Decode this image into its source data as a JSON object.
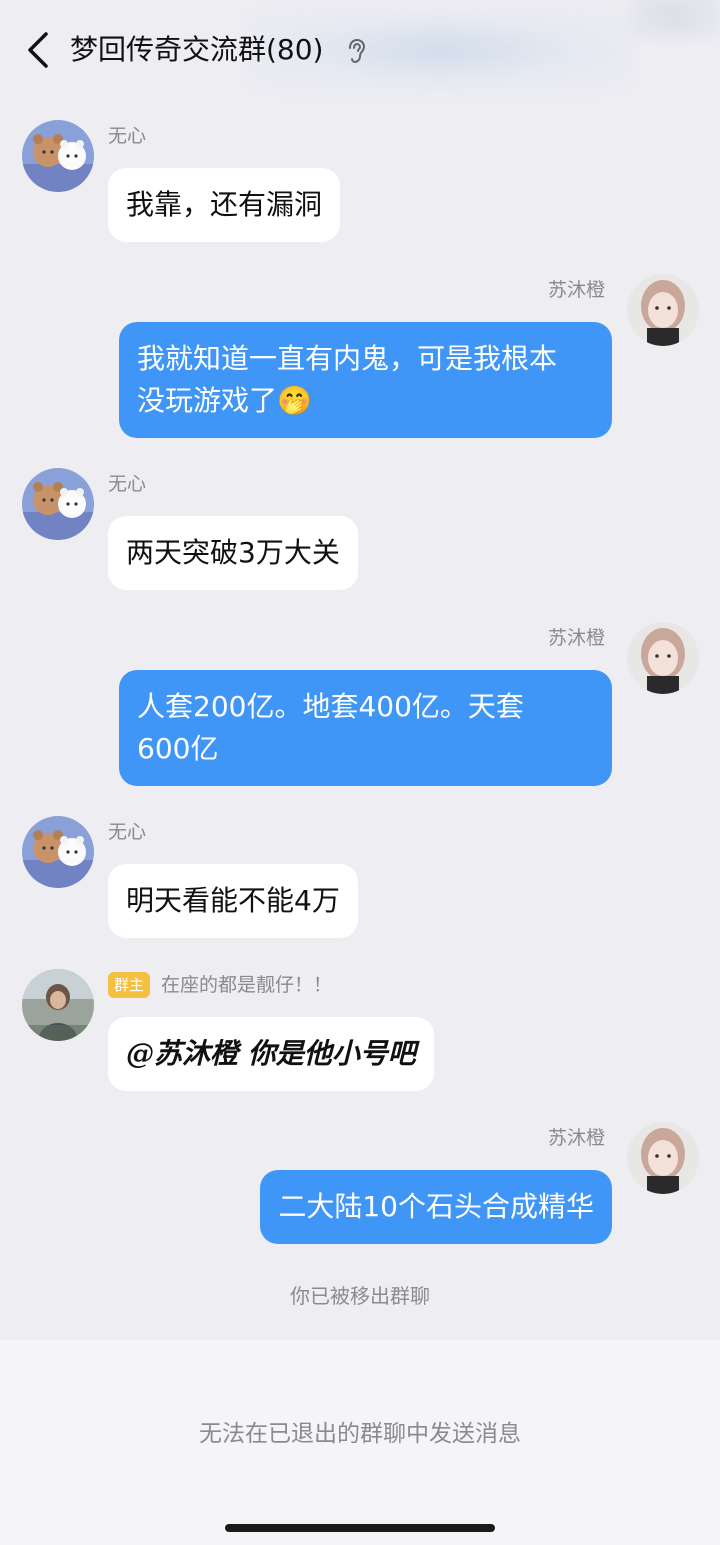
{
  "header": {
    "title": "梦回传奇交流群(80)",
    "back_icon": "chevron-left-icon",
    "ear_icon": "ear-icon"
  },
  "messages": [
    {
      "sender": "无心",
      "text": "我靠，还有漏洞",
      "side": "left"
    },
    {
      "sender": "苏沐橙",
      "lines": [
        "我就知道一直有内鬼，可是我根本",
        "没玩游戏了🤭"
      ],
      "side": "right"
    },
    {
      "sender": "无心",
      "text": "两天突破3万大关",
      "side": "left"
    },
    {
      "sender": "苏沐橙",
      "lines": [
        "人套200亿。地套400亿。天套",
        "600亿"
      ],
      "side": "right"
    },
    {
      "sender": "无心",
      "text": "明天看能不能4万",
      "side": "left"
    },
    {
      "badge": "群主",
      "sender": "在座的都是靓仔！！",
      "text": "@苏沐橙 你是他小号吧",
      "side": "left"
    },
    {
      "sender": "苏沐橙",
      "text": "二大陆10个石头合成精华",
      "side": "right"
    }
  ],
  "system_note": "你已被移出群聊",
  "bottom_notice": "无法在已退出的群聊中发送消息",
  "colors": {
    "outgoing_bubble": "#3f96f6",
    "incoming_bubble": "#ffffff",
    "background": "#ededf2",
    "badge": "#f5c042"
  }
}
